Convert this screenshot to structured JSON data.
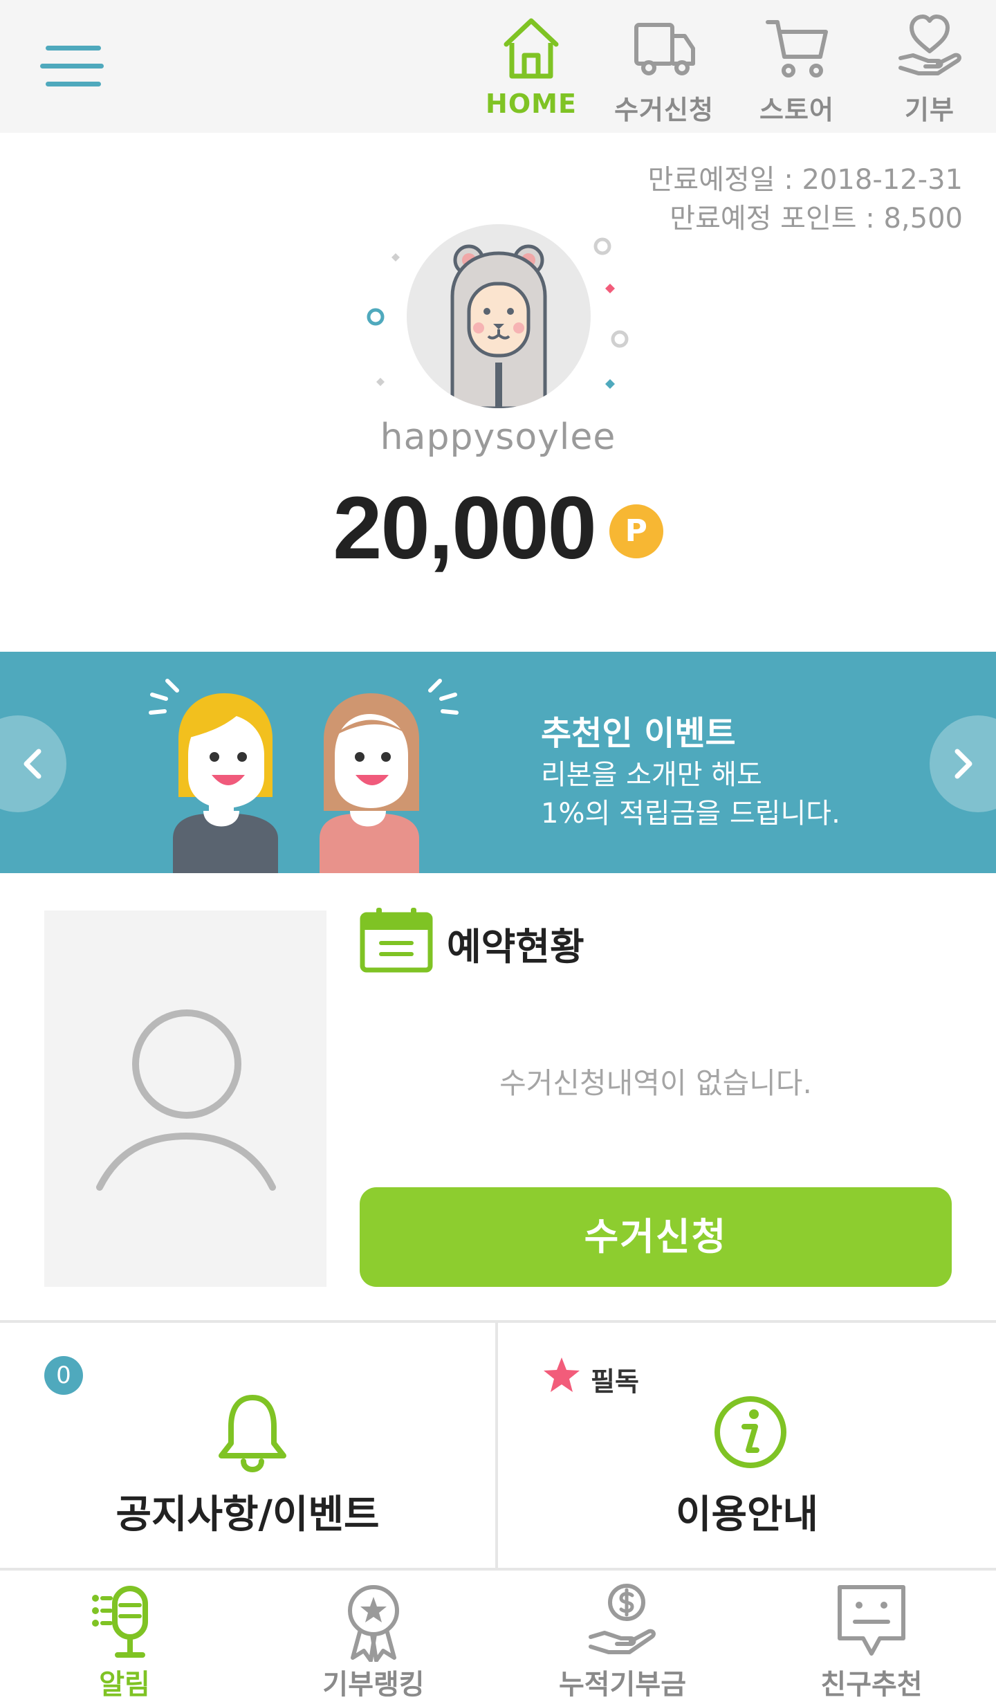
{
  "header": {
    "menu_icon": "hamburger-icon",
    "nav": [
      {
        "label": "HOME",
        "icon": "home-icon",
        "active": true
      },
      {
        "label": "수거신청",
        "icon": "truck-icon",
        "active": false
      },
      {
        "label": "스토어",
        "icon": "cart-icon",
        "active": false
      },
      {
        "label": "기부",
        "icon": "heart-hand-icon",
        "active": false
      }
    ]
  },
  "profile": {
    "expiry_date": "만료예정일 : 2018-12-31",
    "expiry_points": "만료예정 포인트 : 8,500",
    "username": "happysoylee",
    "points": "20,000",
    "points_badge": "P"
  },
  "banner": {
    "title": "추천인 이벤트",
    "line1": "리본을 소개만 해도",
    "line2": "1%의 적립금을 드립니다."
  },
  "reservation": {
    "title": "예약현황",
    "empty_message": "수거신청내역이 없습니다.",
    "button_label": "수거신청"
  },
  "cards": {
    "notice": {
      "count": "0",
      "label": "공지사항/이벤트"
    },
    "guide": {
      "tag": "필독",
      "label": "이용안내"
    }
  },
  "bottom_nav": [
    {
      "label": "알림",
      "icon": "notification-list-icon",
      "active": true
    },
    {
      "label": "기부랭킹",
      "icon": "ranking-medal-icon",
      "active": false
    },
    {
      "label": "누적기부금",
      "icon": "donation-coin-icon",
      "active": false
    },
    {
      "label": "친구추천",
      "icon": "recommend-chat-icon",
      "active": false
    }
  ],
  "colors": {
    "accent_green": "#8dcd2f",
    "active_green": "#7fc324",
    "teal": "#4fa9bd",
    "points_badge": "#f7b733",
    "star_pink": "#f25c7a"
  }
}
